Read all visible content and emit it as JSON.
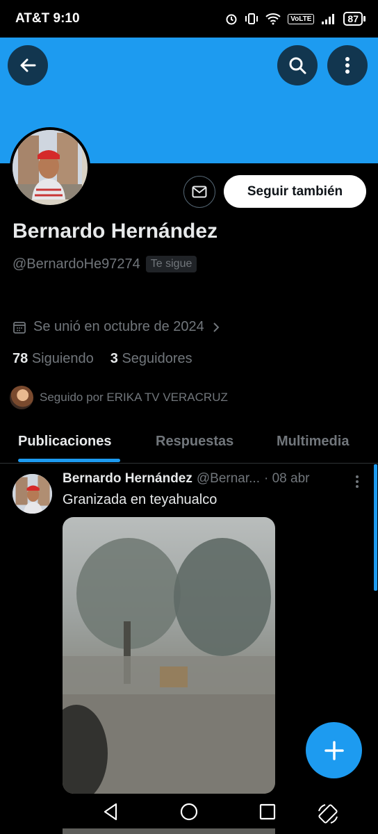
{
  "status_bar": {
    "carrier": "AT&T",
    "time": "9:10",
    "volte": "VoLTE",
    "battery": "87"
  },
  "header": {
    "back_icon": "arrow-left-icon",
    "search_icon": "search-icon",
    "more_icon": "more-vertical-icon",
    "banner_color": "#1d9bf0"
  },
  "profile": {
    "name": "Bernardo Hernández",
    "handle": "@BernardoHe97274",
    "follows_you": "Te sigue",
    "joined": "Se unió en octubre de 2024",
    "following_count": "78",
    "following_label": "Siguiendo",
    "followers_count": "3",
    "followers_label": "Seguidores",
    "followed_by": "Seguido por ERIKA TV VERACRUZ",
    "follow_button": "Seguir también"
  },
  "tabs": [
    {
      "label": "Publicaciones",
      "active": true
    },
    {
      "label": "Respuestas",
      "active": false
    },
    {
      "label": "Multimedia",
      "active": false
    }
  ],
  "post": {
    "author": "Bernardo Hernández",
    "handle": "@Bernar...",
    "date": "· 08 abr",
    "text": "Granizada en teyahualco"
  },
  "colors": {
    "accent": "#1d9bf0",
    "background": "#000000",
    "muted": "#71767b"
  }
}
